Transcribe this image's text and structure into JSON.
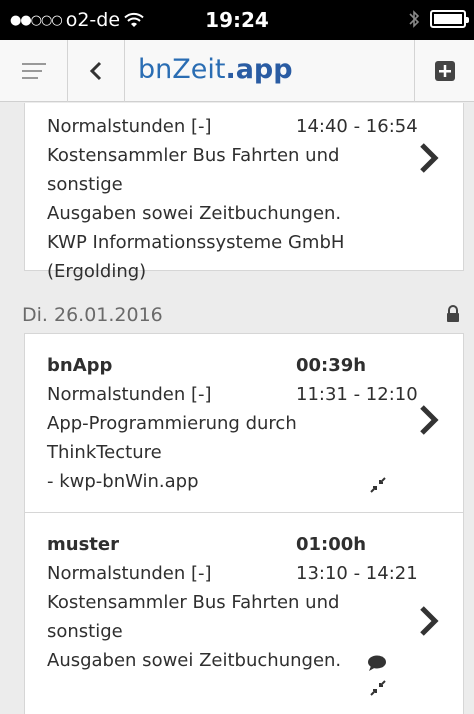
{
  "status_bar": {
    "carrier": "o2-de",
    "time": "19:24",
    "signal_dots": "●●○○○"
  },
  "nav": {
    "logo_prefix": "bnZeit",
    "logo_suffix": ".app"
  },
  "entries_top": {
    "line1_left": "Normalstunden [-]",
    "line1_right": "14:40 - 16:54",
    "desc1": "Kostensammler Bus Fahrten und sonstige",
    "desc2": "Ausgaben sowei Zeitbuchungen.",
    "desc3": "KWP Informationssysteme GmbH",
    "desc4": "(Ergolding)"
  },
  "day": {
    "label": "Di. 26.01.2016"
  },
  "entry1": {
    "project": "bnApp",
    "duration": "00:39h",
    "type": "Normalstunden [-]",
    "range": "11:31 - 12:10",
    "desc1": "App-Programmierung durch ThinkTecture",
    "desc2": "- kwp-bnWin.app"
  },
  "entry2": {
    "project": "muster",
    "duration": "01:00h",
    "type": "Normalstunden [-]",
    "range": "13:10 - 14:21",
    "desc1": "Kostensammler Bus Fahrten und sonstige",
    "desc2": "Ausgaben sowei Zeitbuchungen."
  },
  "icons": {
    "menu": "hamburger-icon",
    "back": "chevron-left-icon",
    "add": "plus-square-icon",
    "detail": "chevron-right-icon",
    "lock": "lock-icon",
    "collapse": "compress-arrows-icon",
    "comment": "comment-icon"
  },
  "colors": {
    "brand": "#2a6db3",
    "background": "#ececec"
  }
}
